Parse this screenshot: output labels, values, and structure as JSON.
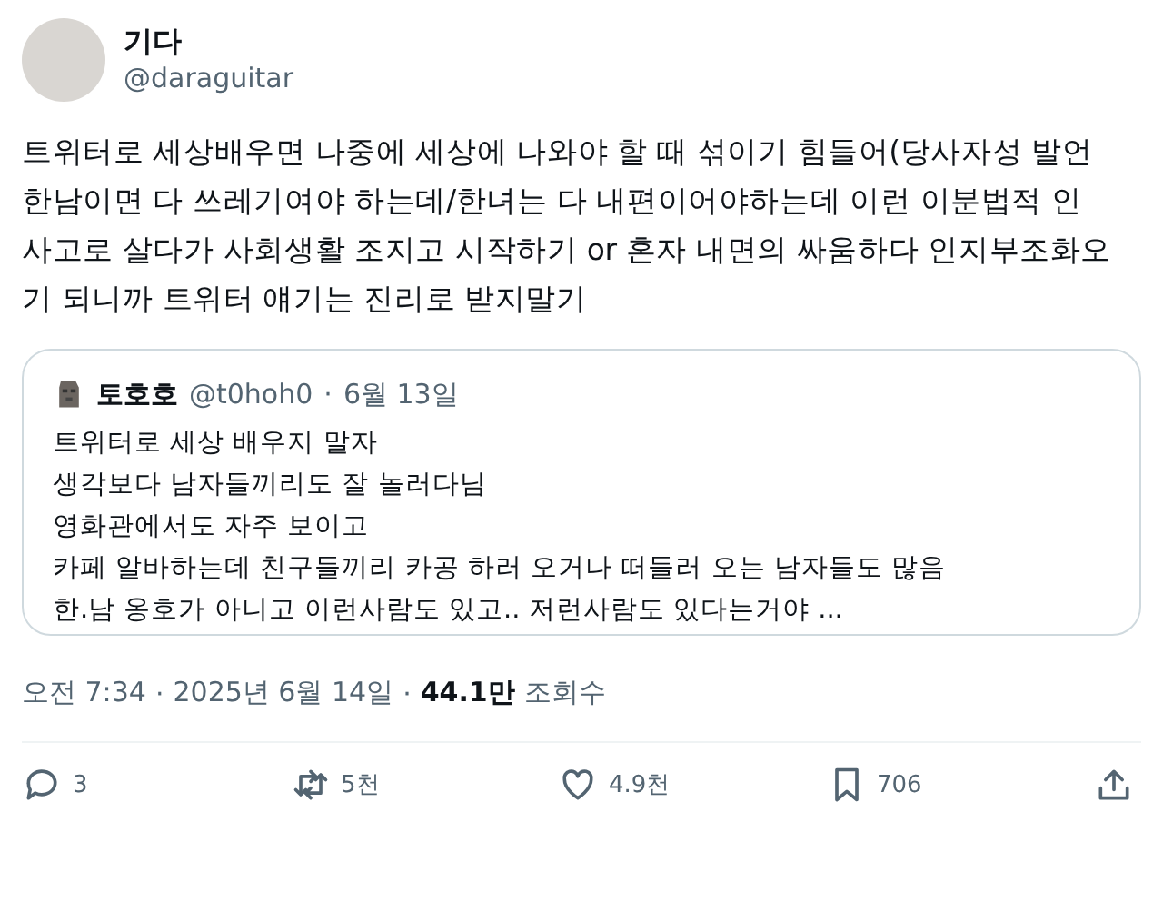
{
  "author": {
    "name": "기다",
    "handle": "@daraguitar"
  },
  "body": "트위터로 세상배우면 나중에 세상에 나와야 할 때 섞이기 힘들어(당사자성 발언\n한남이면 다 쓰레기여야 하는데/한녀는 다 내편이어야하는데 이런 이분법적 인 사고로 살다가 사회생활 조지고 시작하기 or 혼자 내면의 싸움하다 인지부조화오기 되니까 트위터 얘기는 진리로 받지말기",
  "quote": {
    "name": "토호호",
    "handle": "@t0hoh0",
    "separator": "·",
    "date": "6월 13일",
    "lines": [
      "트위터로 세상 배우지 말자",
      "생각보다 남자들끼리도 잘 놀러다님",
      "영화관에서도 자주 보이고",
      "카페 알바하는데 친구들끼리 카공 하러 오거나 떠들러 오는 남자들도 많음",
      "한.남 옹호가 아니고 이런사람도 있고.. 저런사람도 있다는거야 ..."
    ]
  },
  "meta": [
    {
      "kind": "text",
      "text": "오전 7:34"
    },
    {
      "kind": "sep",
      "text": "·"
    },
    {
      "kind": "text",
      "text": "2025년 6월 14일"
    },
    {
      "kind": "sep",
      "text": "·"
    },
    {
      "kind": "strong",
      "text": "44.1만"
    },
    {
      "kind": "text",
      "text": "조회수"
    }
  ],
  "actions": [
    {
      "kind": "reply",
      "count": "3"
    },
    {
      "kind": "retweet",
      "count": "5천"
    },
    {
      "kind": "like",
      "count": "4.9천"
    },
    {
      "kind": "bookmark",
      "count": "706"
    },
    {
      "kind": "share"
    }
  ]
}
